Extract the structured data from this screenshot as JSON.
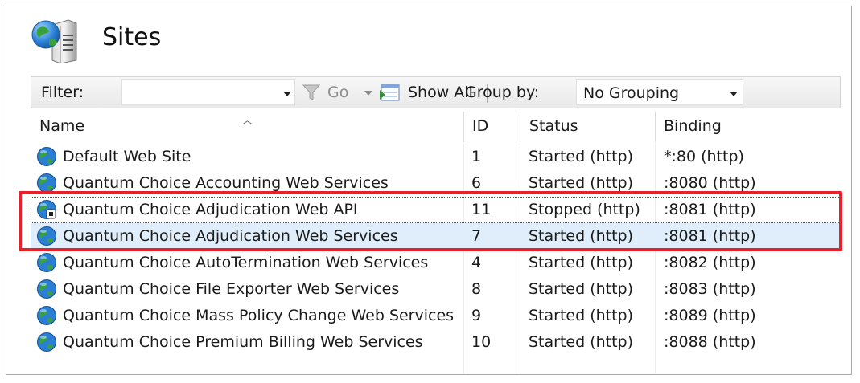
{
  "page": {
    "title": "Sites"
  },
  "toolbar": {
    "filter_label": "Filter:",
    "filter_value": "",
    "go_label": "Go",
    "show_all_label": "Show All",
    "group_by_label": "Group by:",
    "group_by_value": "No Grouping"
  },
  "columns": {
    "name": "Name",
    "id": "ID",
    "status": "Status",
    "binding": "Binding"
  },
  "sites": [
    {
      "name": "Default Web Site",
      "id": "1",
      "status": "Started (http)",
      "binding": "*:80 (http)"
    },
    {
      "name": "Quantum Choice Accounting Web Services",
      "id": "6",
      "status": "Started (http)",
      "binding": ":8080 (http)"
    },
    {
      "name": "Quantum Choice Adjudication Web API",
      "id": "11",
      "status": "Stopped (http)",
      "binding": ":8081 (http)"
    },
    {
      "name": "Quantum Choice Adjudication Web Services",
      "id": "7",
      "status": "Started (http)",
      "binding": ":8081 (http)"
    },
    {
      "name": "Quantum Choice AutoTermination Web Services",
      "id": "4",
      "status": "Started (http)",
      "binding": ":8082 (http)"
    },
    {
      "name": "Quantum Choice File Exporter Web Services",
      "id": "8",
      "status": "Started (http)",
      "binding": ":8083 (http)"
    },
    {
      "name": "Quantum Choice Mass Policy Change Web Services",
      "id": "9",
      "status": "Started (http)",
      "binding": ":8089 (http)"
    },
    {
      "name": "Quantum Choice Premium Billing Web Services",
      "id": "10",
      "status": "Started (http)",
      "binding": ":8088 (http)"
    }
  ],
  "colors": {
    "highlight": "#e8202c",
    "selected_row": "#dfeefa"
  },
  "icons": {
    "header": "server-globe-icon",
    "site": "globe-icon",
    "stopped_site": "globe-stopped-icon",
    "go": "funnel-icon",
    "show_all": "show-all-icon"
  }
}
